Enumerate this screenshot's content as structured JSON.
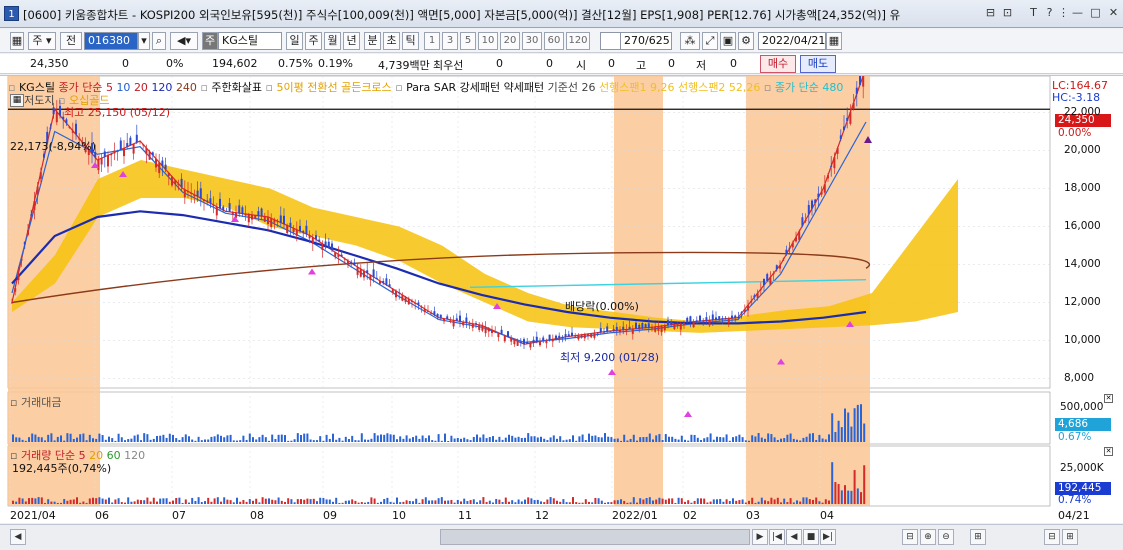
{
  "title_bar": {
    "text": "[0600] 키움종합차트 - KOSPI200 외국인보유[595(천)] 주식수[100,009(천)] 액면[5,000] 자본금[5,000(억)] 결산[12월] EPS[1,908] PER[12.76] 시가총액[24,352(억)] 유",
    "icon_label": "1",
    "buttons": [
      "⊟",
      "⊡",
      "T",
      "?",
      "⋮",
      "—",
      "□",
      "✕"
    ]
  },
  "toolbar": {
    "market_label": "주",
    "market2_label": "전",
    "code_value": "016380",
    "name_prefix": "주",
    "stock_name": "KG스틸",
    "periods": [
      {
        "label": "일",
        "selected": true
      },
      {
        "label": "주",
        "selected": false
      },
      {
        "label": "월",
        "selected": false
      },
      {
        "label": "년",
        "selected": false
      },
      {
        "label": "분",
        "selected": false
      },
      {
        "label": "초",
        "selected": false
      },
      {
        "label": "틱",
        "selected": false
      }
    ],
    "intervals": [
      "1",
      "3",
      "5",
      "10",
      "20",
      "30",
      "60",
      "120"
    ],
    "count": "270/625",
    "date": "2022/04/21"
  },
  "quote_bar": {
    "price": "24,350",
    "change": "0",
    "change_pct": "0%",
    "volume": "194,602",
    "volume_pct": "0.75%",
    "turnover_pct": "0.19%",
    "amount": "4,739백만",
    "priority_label": "최우선",
    "priority_val": "0",
    "priority_val2": "0",
    "open_label": "시",
    "open_val": "0",
    "high_label": "고",
    "high_val": "0",
    "low_label": "저",
    "low_val": "0",
    "buy_label": "매수",
    "sell_label": "매도"
  },
  "price_legend": {
    "stock": "KG스틸",
    "ma_label": "종가 단순",
    "ma_periods": [
      "5",
      "10",
      "20",
      "120",
      "240"
    ],
    "indicator1": "주한화살표",
    "indicator2": "5이평 전환선 골든크로스",
    "indicator3": "Para SAR",
    "indicator4": "강세패턴",
    "indicator5": "약세패턴",
    "kijun": "기준선 26",
    "span1": "선행스팬1 9,26",
    "span2": "선행스팬2 52,26",
    "ma480": "종가 단순 480",
    "row2_a": "고저도지",
    "row2_b": "오십골드",
    "lc": "LC:164.67",
    "hc": "HC:-3.18"
  },
  "annotations": {
    "high": "최고 25,150 (05/12)",
    "level": "22,173(-8,94%)",
    "dividend": "배당락(0.00%)",
    "low": "최저 9,200 (01/28)",
    "last_price": "24,350",
    "last_pct": "0.00%"
  },
  "y_axis": [
    "22,000",
    "20,000",
    "18,000",
    "16,000",
    "14,000",
    "12,000",
    "10,000",
    "8,000"
  ],
  "amount_panel": {
    "title": "거래대금",
    "tick": "500,000",
    "last_val": "4,686",
    "last_pct": "0.67%"
  },
  "volume_panel": {
    "title": "거래량",
    "ma_label": "단순",
    "periods": [
      "5",
      "20",
      "60",
      "120"
    ],
    "last_text": "192,445주(0,74%)",
    "tick": "25,000K",
    "last_val": "192,445",
    "last_pct": "0.74%"
  },
  "x_axis": [
    "2021/04",
    "06",
    "07",
    "08",
    "09",
    "10",
    "11",
    "12",
    "2022/01",
    "02",
    "03",
    "04"
  ],
  "x_axis_right": "04/21",
  "chart_data": {
    "type": "line",
    "title": "KG스틸",
    "x_range": [
      "2021/04",
      "2022/04/21"
    ],
    "ylim": [
      7500,
      23500
    ],
    "series": [
      {
        "name": "종가",
        "values": [
          12000,
          22173,
          19500,
          20500,
          18000,
          16800,
          16500,
          15500,
          14000,
          12600,
          11200,
          10800,
          9800,
          10200,
          10500,
          10700,
          11000,
          11200,
          14000,
          18000,
          24350
        ]
      },
      {
        "name": "5",
        "values": [
          12500,
          21000,
          19800,
          20200,
          17800,
          16700,
          16300,
          15200,
          13800,
          12400,
          11100,
          10700,
          9900,
          10100,
          10400,
          10600,
          10900,
          11100,
          13500,
          17500,
          21500
        ]
      },
      {
        "name": "120",
        "values": [
          13000,
          15500,
          16500,
          16800,
          16600,
          16200,
          15800,
          15200,
          14500,
          13800,
          13000,
          12400,
          11900,
          11500,
          11200,
          11000,
          10900,
          10900,
          11000,
          11200,
          11500
        ]
      }
    ],
    "events": [
      "최고 25,150 (05/12)",
      "최저 9,200 (01/28)",
      "배당락(0.00%)"
    ]
  },
  "scrollbar": {
    "buttons": [
      "▶",
      "|◀",
      "◀",
      "■",
      "▶|",
      "⊟",
      "⊕",
      "⊖",
      "⊞",
      "⊟",
      "⊞"
    ]
  }
}
